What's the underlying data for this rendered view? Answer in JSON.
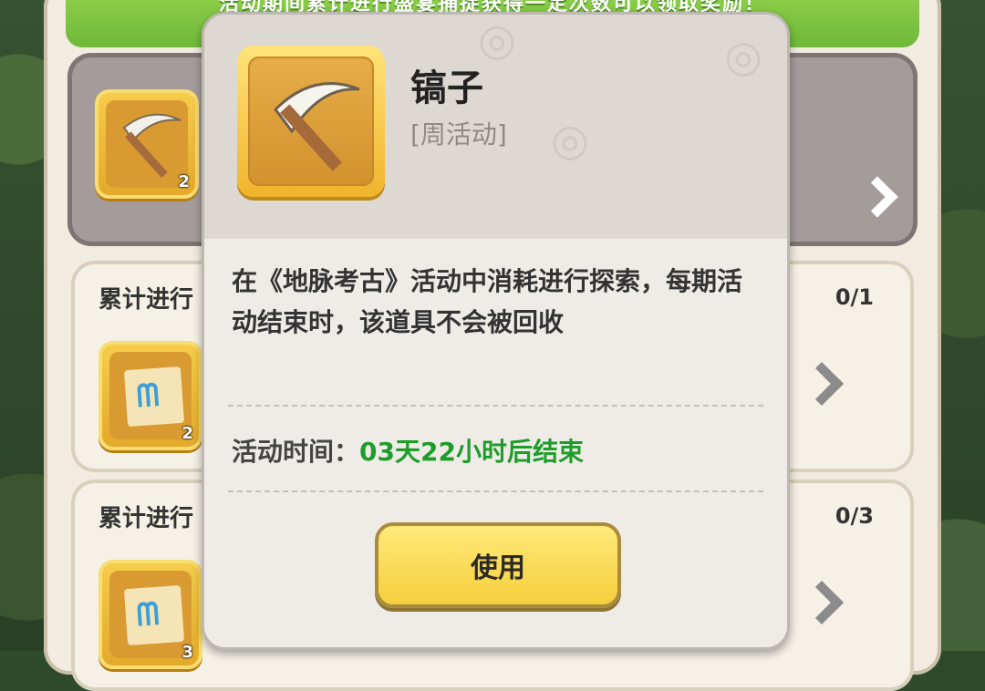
{
  "banner": {
    "text": "活动期间累计进行盛宴捕捉获得一定次数可以领取奖励！"
  },
  "event_item": {
    "count": "2"
  },
  "tasks": [
    {
      "title": "累计进行",
      "progress": "0/1",
      "reward_count": "2"
    },
    {
      "title": "累计进行",
      "progress": "0/3",
      "reward_count": "3"
    }
  ],
  "modal": {
    "item_name": "镐子",
    "item_tag": "[周活动]",
    "description": "在《地脉考古》活动中消耗进行探索，每期活动结束时，该道具不会被回收",
    "time_label": "活动时间：",
    "time_value": "03天22小时后结束",
    "use_button": "使用"
  },
  "colors": {
    "accent_green": "#1f9d2a",
    "button_yellow": "#f6cf3c"
  }
}
